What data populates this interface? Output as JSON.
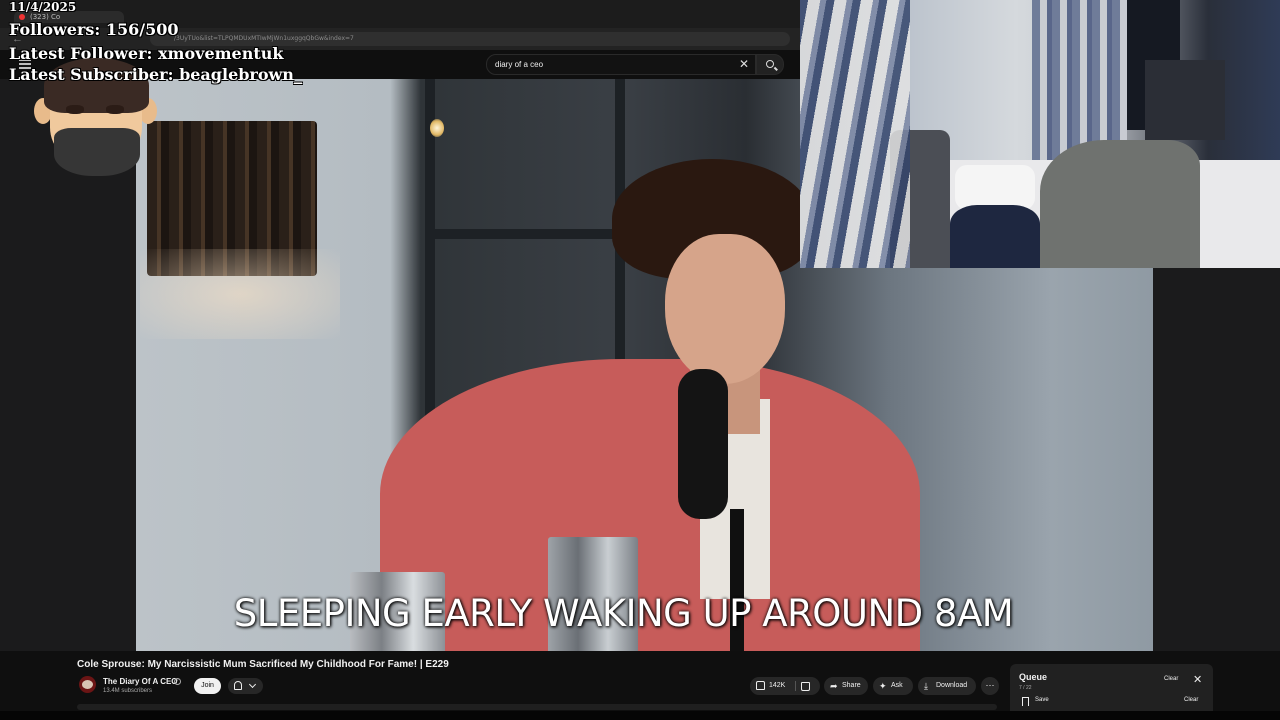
{
  "browser": {
    "tab_label": "(323) Co",
    "url": "/3UyTUo&list=TLPQMDUxMTIwMjWn1uxggqQbGw&index=7"
  },
  "search": {
    "query": "diary of a ceo"
  },
  "video": {
    "caption": "SLEEPING EARLY WAKING UP AROUND 8AM",
    "title": "Cole Sprouse: My Narcissistic Mum Sacrificed My Childhood For Fame! | E229"
  },
  "channel": {
    "name": "The Diary Of A CEO",
    "subscribers": "13.4M subscribers",
    "join_label": "Join"
  },
  "actions": {
    "likes": "142K",
    "share_label": "Share",
    "ask_label": "Ask",
    "download_label": "Download",
    "more_label": "⋯"
  },
  "queue": {
    "title": "Queue",
    "count": "7 / 22",
    "clear_label": "Clear",
    "save_label": "Save",
    "clear_bottom_label": "Clear"
  },
  "stream_overlay": {
    "date": "11/4/2025",
    "followers": "Followers: 156/500",
    "latest_follower": "Latest Follower: xmovementuk",
    "latest_subscriber": "Latest Subscriber: beaglebrown_"
  },
  "icons": {
    "search": "search-icon",
    "clear": "close-icon",
    "menu": "hamburger-menu-icon",
    "bell": "bell-icon",
    "like": "thumbs-up-icon",
    "dislike": "thumbs-down-icon",
    "share": "share-arrow-icon",
    "ask": "sparkle-icon",
    "download": "download-icon",
    "save": "bookmark-icon"
  },
  "colors": {
    "background": "#0f0f0f",
    "pill": "#272727",
    "join_button": "#f1f1f1",
    "youtube_red": "#ff0000"
  }
}
